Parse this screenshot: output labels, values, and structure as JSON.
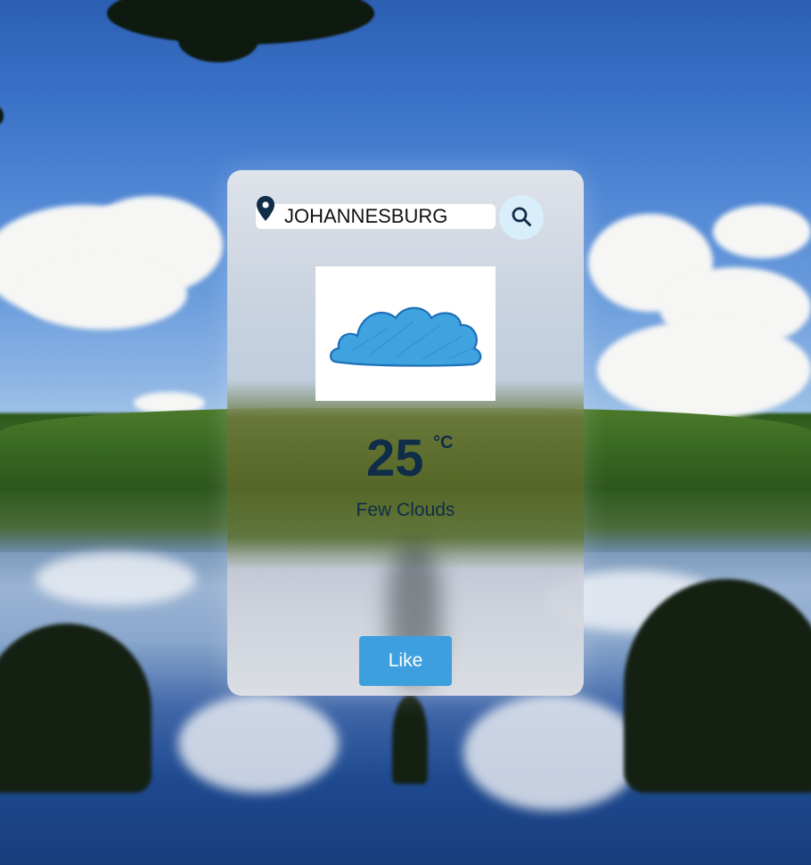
{
  "search": {
    "value": "JOHANNESBURG",
    "icon": "map-pin-icon",
    "button_icon": "search-icon"
  },
  "weather": {
    "image_icon": "cloud-icon",
    "temperature": "25",
    "unit": "°C",
    "condition": "Few Clouds"
  },
  "like": {
    "label": "Like"
  },
  "colors": {
    "text_dark": "#0f2c48",
    "button_blue": "#3e9fde",
    "search_button_bg": "#d9eefb"
  }
}
